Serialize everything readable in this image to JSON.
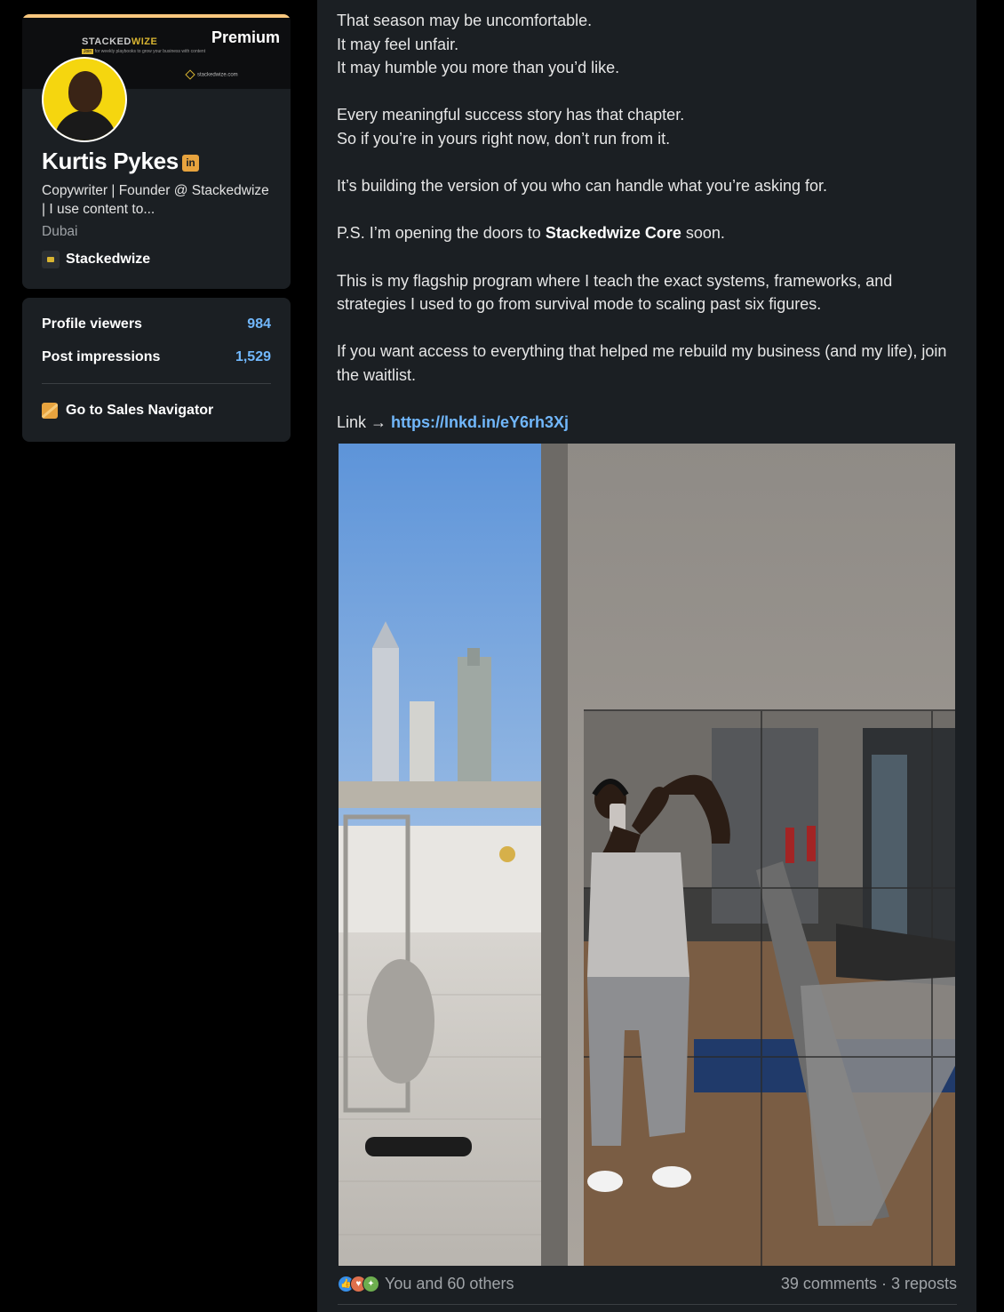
{
  "sidebar": {
    "banner": {
      "brand_a": "STACKED",
      "brand_b": "WIZE",
      "tag_highlight": "Join",
      "tagline": "for weekly playbooks to grow your business with content",
      "url": "stackedwize.com"
    },
    "premium_label": "Premium",
    "name": "Kurtis Pykes",
    "badge": "in",
    "headline": "Copywriter | Founder @ Stackedwize | I use content to...",
    "location": "Dubai",
    "company": "Stackedwize",
    "stats": [
      {
        "label": "Profile viewers",
        "value": "984"
      },
      {
        "label": "Post impressions",
        "value": "1,529"
      }
    ],
    "sales_navigator": "Go to Sales Navigator"
  },
  "post": {
    "lines": {
      "l1": "That season may be uncomfortable.",
      "l2": "It may feel unfair.",
      "l3": "It may humble you more than you’d like.",
      "l4": "Every meaningful success story has that chapter.",
      "l5": "So if you’re in yours right now, don’t run from it.",
      "l6": "It’s building the version of you who can handle what you’re asking for.",
      "l7a": "P.S. I’m opening the doors to ",
      "l7b": "Stackedwize Core",
      "l7c": " soon.",
      "l8": "This is my flagship program where I teach the exact systems, frameworks, and strategies I used to go from survival mode to scaling past six figures.",
      "l9": "If you want access to everything that helped me rebuild my business (and my life), join the waitlist.",
      "link_prefix": "Link → ",
      "link_url": "https://lnkd.in/eY6rh3Xj"
    },
    "reactions_text": "You and 60 others",
    "engagement": "39 comments · 3 reposts",
    "reaction_icons": [
      "like-icon",
      "love-icon",
      "insightful-icon"
    ]
  },
  "colors": {
    "background": "#000000",
    "card": "#1b1f23",
    "link": "#71b7fb",
    "premium_gold": "#f8c77e",
    "badge": "#e7a33e"
  }
}
